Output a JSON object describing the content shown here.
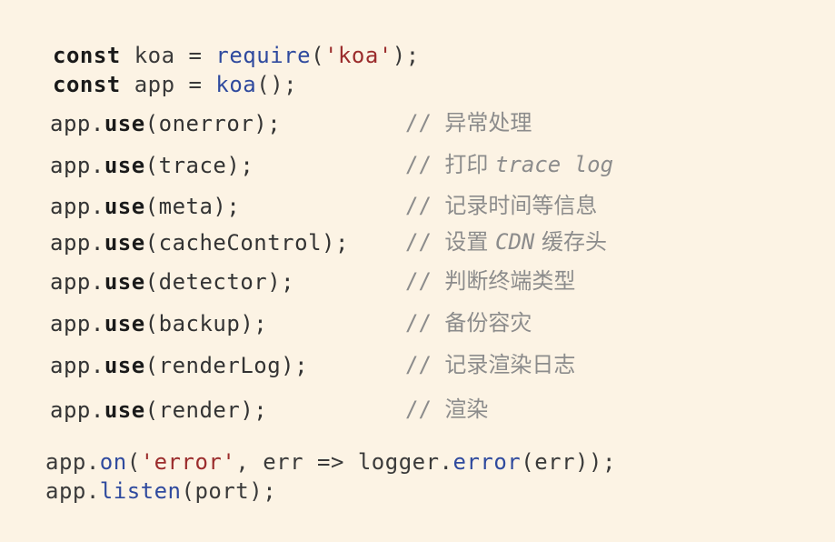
{
  "header": {
    "line1": {
      "kw": "const",
      "name": " koa = ",
      "fn": "require",
      "open": "(",
      "str": "'koa'",
      "close": ");"
    },
    "line2": {
      "kw": "const",
      "name": " app = ",
      "fn": "koa",
      "rest": "();"
    }
  },
  "uses": [
    {
      "obj": "app",
      "dot": ".",
      "method": "use",
      "arg": "(onerror);",
      "comment_slash": "// ",
      "comment_text": "异常处理",
      "comment_extra": ""
    },
    {
      "obj": "app",
      "dot": ".",
      "method": "use",
      "arg": "(trace);",
      "comment_slash": "// ",
      "comment_text": "打印 ",
      "comment_extra": "trace log"
    },
    {
      "obj": "app",
      "dot": ".",
      "method": "use",
      "arg": "(meta);",
      "comment_slash": "// ",
      "comment_text": "记录时间等信息",
      "comment_extra": ""
    },
    {
      "obj": "app",
      "dot": ".",
      "method": "use",
      "arg": "(cacheControl);",
      "comment_slash": "// ",
      "comment_text": "设置 ",
      "comment_extra": "CDN",
      "comment_tail": " 缓存头"
    },
    {
      "obj": "app",
      "dot": ".",
      "method": "use",
      "arg": "(detector);",
      "comment_slash": "// ",
      "comment_text": "判断终端类型",
      "comment_extra": ""
    },
    {
      "obj": "app",
      "dot": ".",
      "method": "use",
      "arg": "(backup);",
      "comment_slash": "// ",
      "comment_text": "备份容灾",
      "comment_extra": ""
    },
    {
      "obj": "app",
      "dot": ".",
      "method": "use",
      "arg": "(renderLog);",
      "comment_slash": "// ",
      "comment_text": "记录渲染日志",
      "comment_extra": ""
    },
    {
      "obj": "app",
      "dot": ".",
      "method": "use",
      "arg": "(render);",
      "comment_slash": "// ",
      "comment_text": "渲染",
      "comment_extra": ""
    }
  ],
  "footer": {
    "on": {
      "obj": "app.",
      "fn": "on",
      "open": "(",
      "str": "'error'",
      "mid": ", err => logger.",
      "fn2": "error",
      "rest": "(err));"
    },
    "listen": {
      "obj": "app.",
      "fn": "listen",
      "rest": "(port);"
    }
  },
  "colors": {
    "background": "#fcf3e4",
    "keyword": "#1a1a1a",
    "function": "#2f4a9e",
    "string": "#9b2c2c",
    "comment": "#8c8c8c"
  }
}
